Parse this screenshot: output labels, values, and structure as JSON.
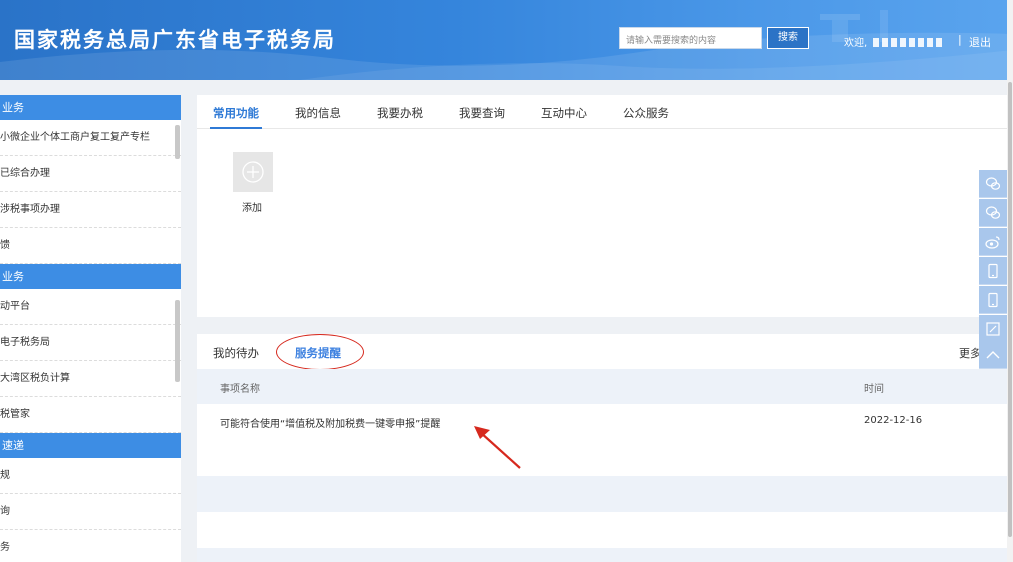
{
  "header": {
    "site_title": "国家税务总局广东省电子税务局",
    "search_placeholder": "请输入需要搜索的内容",
    "search_button": "搜索",
    "welcome": "欢迎,",
    "separator": "|",
    "logout": "退出"
  },
  "sidebar": {
    "sections": [
      {
        "title": "业务",
        "items": [
          "小微企业个体工商户复工复产专栏",
          "已综合办理",
          "涉税事项办理",
          "馈"
        ]
      },
      {
        "title": "业务",
        "items": [
          "动平台",
          "电子税务局",
          "大湾区税负计算",
          "税管家"
        ]
      },
      {
        "title": "速递",
        "items": [
          "规",
          "询",
          "务"
        ]
      }
    ]
  },
  "tabs": [
    "常用功能",
    "我的信息",
    "我要办税",
    "我要查询",
    "互动中心",
    "公众服务"
  ],
  "quick_functions": {
    "add_label": "添加"
  },
  "lower_panel": {
    "sub_tabs": {
      "todo": "我的待办",
      "remind": "服务提醒"
    },
    "more": "更多",
    "columns": {
      "name": "事项名称",
      "time": "时间"
    },
    "rows": [
      {
        "name": "可能符合使用“增值税及附加税费一键零申报”提醒",
        "time": "2022-12-16"
      }
    ]
  },
  "float_toolbar": [
    "wechat-icon",
    "wechat-icon",
    "weibo-icon",
    "mobile-icon",
    "mobile-icon",
    "edit-icon",
    "chevron-up-icon"
  ],
  "colors": {
    "brand_blue": "#2f7ad6",
    "sidebar_header": "#3d8de4",
    "annotation_red": "#d6291e"
  }
}
